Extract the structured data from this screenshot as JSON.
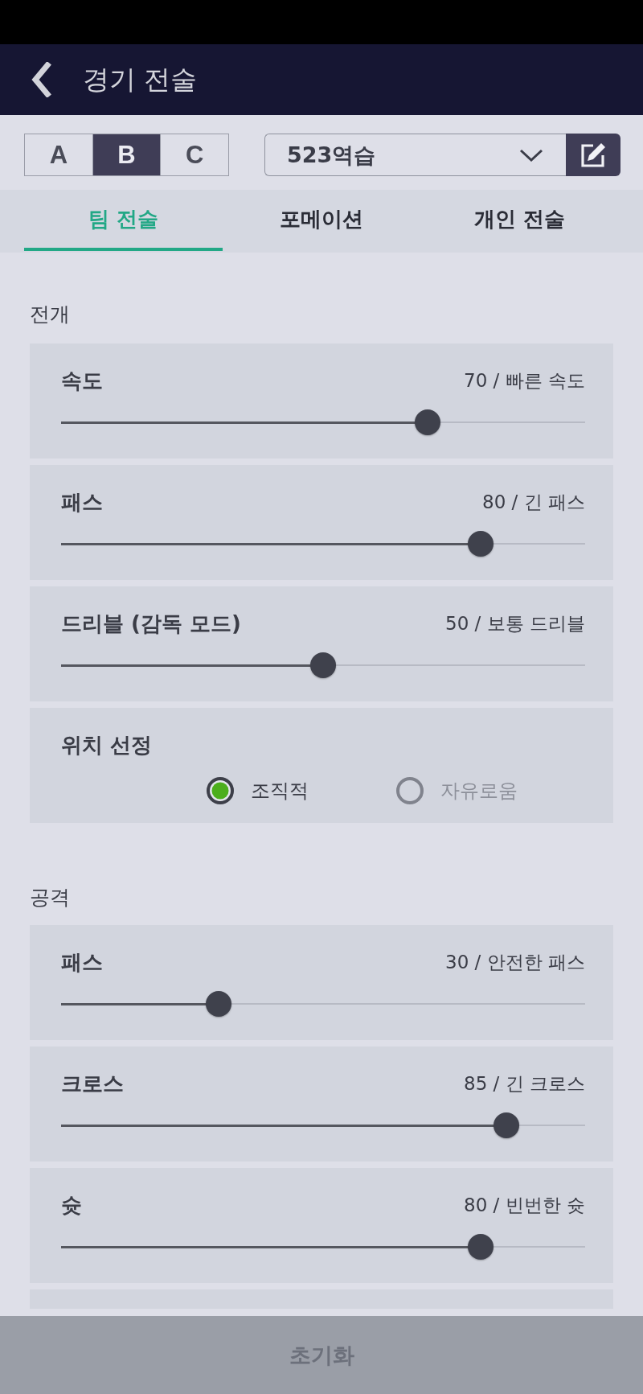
{
  "header": {
    "title": "경기 전술"
  },
  "presets": [
    {
      "label": "A",
      "selected": false
    },
    {
      "label": "B",
      "selected": true
    },
    {
      "label": "C",
      "selected": false
    }
  ],
  "tactic_select": {
    "value": "523역습"
  },
  "tabs": [
    {
      "label": "팀 전술",
      "selected": true
    },
    {
      "label": "포메이션",
      "selected": false
    },
    {
      "label": "개인 전술",
      "selected": false
    }
  ],
  "sections": [
    {
      "title": "전개",
      "settings": [
        {
          "kind": "slider",
          "label": "속도",
          "level": 0.7,
          "reading": "70 / 빠른 속도"
        },
        {
          "kind": "slider",
          "label": "패스",
          "level": 0.8,
          "reading": "80 / 긴 패스"
        },
        {
          "kind": "slider",
          "label": "드리블 (감독 모드)",
          "level": 0.5,
          "reading": "50 / 보통 드리블"
        },
        {
          "kind": "radio",
          "label": "위치 선정",
          "options": [
            {
              "label": "조직적",
              "selected": true
            },
            {
              "label": "자유로움",
              "selected": false
            }
          ]
        }
      ]
    },
    {
      "title": "공격",
      "settings": [
        {
          "kind": "slider",
          "label": "패스",
          "level": 0.3,
          "reading": "30 / 안전한 패스"
        },
        {
          "kind": "slider",
          "label": "크로스",
          "level": 0.85,
          "reading": "85 / 긴 크로스"
        },
        {
          "kind": "slider",
          "label": "슛",
          "level": 0.8,
          "reading": "80 / 빈번한 슛"
        }
      ]
    }
  ],
  "reset_button": {
    "label": "초기화"
  }
}
